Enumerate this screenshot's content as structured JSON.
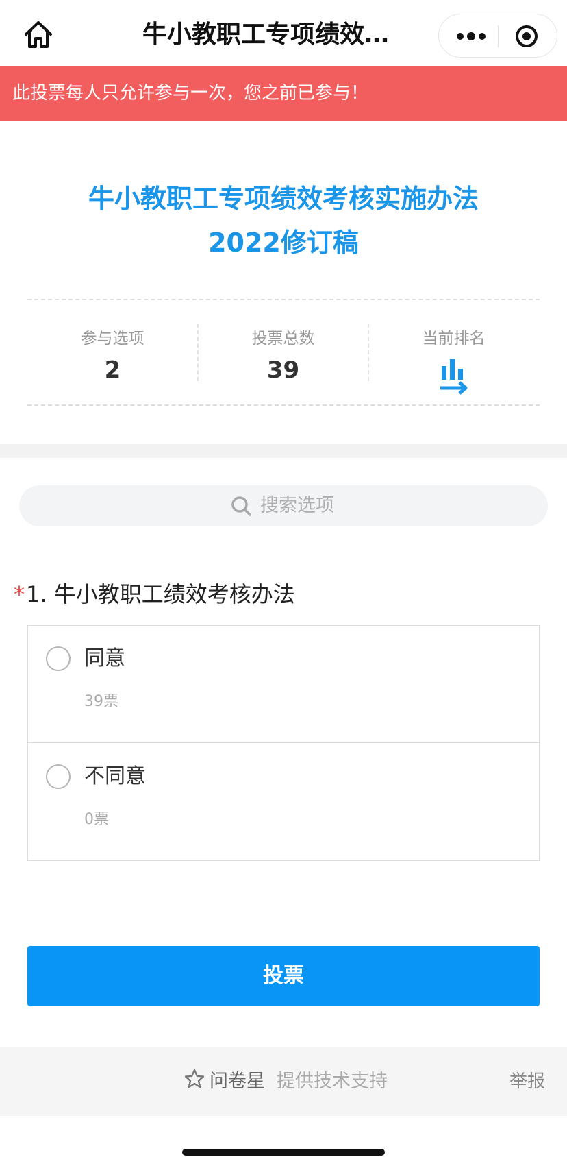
{
  "navbar": {
    "title": "牛小教职工专项绩效…",
    "home_icon": "home-icon",
    "more_icon": "more-dots-icon",
    "close_icon": "target-close-icon"
  },
  "alert": {
    "text": "此投票每人只允许参与一次，您之前已参与！",
    "bg_color": "#f25d5d"
  },
  "survey": {
    "title_line1": "牛小教职工专项绩效考核实施办法",
    "title_line2": "2022修订稿",
    "title_color": "#1a95e8"
  },
  "stats": {
    "options_label": "参与选项",
    "options_value": "2",
    "total_label": "投票总数",
    "total_value": "39",
    "rank_label": "当前排名",
    "rank_icon": "bar-chart-arrow-icon"
  },
  "search": {
    "placeholder": "搜索选项",
    "icon": "search-icon"
  },
  "question": {
    "required_mark": "*",
    "title": "1. 牛小教职工绩效考核办法",
    "options": [
      {
        "label": "同意",
        "votes": "39票"
      },
      {
        "label": "不同意",
        "votes": "0票"
      }
    ]
  },
  "vote_button": {
    "label": "投票",
    "color": "#0895f5"
  },
  "footer": {
    "brand": "问卷星",
    "support": "提供技术支持",
    "report": "举报",
    "star_icon": "star-icon"
  }
}
